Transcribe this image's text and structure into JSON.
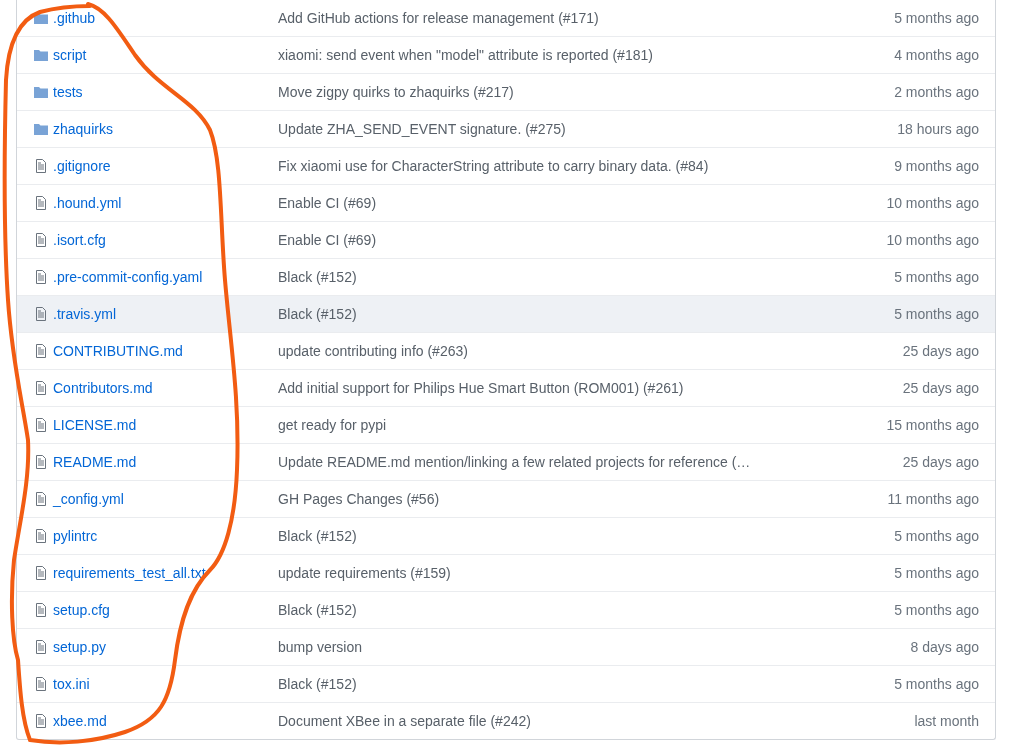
{
  "files": [
    {
      "kind": "dir",
      "name": ".github",
      "message": "Add GitHub actions for release management (#171)",
      "age": "5 months ago",
      "highlighted": false
    },
    {
      "kind": "dir",
      "name": "script",
      "message": "xiaomi: send event when \"model\" attribute is reported (#181)",
      "age": "4 months ago",
      "highlighted": false
    },
    {
      "kind": "dir",
      "name": "tests",
      "message": "Move zigpy quirks to zhaquirks (#217)",
      "age": "2 months ago",
      "highlighted": false
    },
    {
      "kind": "dir",
      "name": "zhaquirks",
      "message": "Update ZHA_SEND_EVENT signature. (#275)",
      "age": "18 hours ago",
      "highlighted": false
    },
    {
      "kind": "file",
      "name": ".gitignore",
      "message": "Fix xiaomi use for CharacterString attribute to carry binary data. (#84)",
      "age": "9 months ago",
      "highlighted": false
    },
    {
      "kind": "file",
      "name": ".hound.yml",
      "message": "Enable CI (#69)",
      "age": "10 months ago",
      "highlighted": false
    },
    {
      "kind": "file",
      "name": ".isort.cfg",
      "message": "Enable CI (#69)",
      "age": "10 months ago",
      "highlighted": false
    },
    {
      "kind": "file",
      "name": ".pre-commit-config.yaml",
      "message": "Black (#152)",
      "age": "5 months ago",
      "highlighted": false
    },
    {
      "kind": "file",
      "name": ".travis.yml",
      "message": "Black (#152)",
      "age": "5 months ago",
      "highlighted": true
    },
    {
      "kind": "file",
      "name": "CONTRIBUTING.md",
      "message": "update contributing info (#263)",
      "age": "25 days ago",
      "highlighted": false
    },
    {
      "kind": "file",
      "name": "Contributors.md",
      "message": "Add initial support for Philips Hue Smart Button (ROM001) (#261)",
      "age": "25 days ago",
      "highlighted": false
    },
    {
      "kind": "file",
      "name": "LICENSE.md",
      "message": "get ready for pypi",
      "age": "15 months ago",
      "highlighted": false
    },
    {
      "kind": "file",
      "name": "README.md",
      "message": "Update README.md mention/linking a few related projects for reference (…",
      "age": "25 days ago",
      "highlighted": false
    },
    {
      "kind": "file",
      "name": "_config.yml",
      "message": "GH Pages Changes (#56)",
      "age": "11 months ago",
      "highlighted": false
    },
    {
      "kind": "file",
      "name": "pylintrc",
      "message": "Black (#152)",
      "age": "5 months ago",
      "highlighted": false
    },
    {
      "kind": "file",
      "name": "requirements_test_all.txt",
      "message": "update requirements (#159)",
      "age": "5 months ago",
      "highlighted": false
    },
    {
      "kind": "file",
      "name": "setup.cfg",
      "message": "Black (#152)",
      "age": "5 months ago",
      "highlighted": false
    },
    {
      "kind": "file",
      "name": "setup.py",
      "message": "bump version",
      "age": "8 days ago",
      "highlighted": false
    },
    {
      "kind": "file",
      "name": "tox.ini",
      "message": "Black (#152)",
      "age": "5 months ago",
      "highlighted": false
    },
    {
      "kind": "file",
      "name": "xbee.md",
      "message": "Document XBee in a separate file (#242)",
      "age": "last month",
      "highlighted": false
    }
  ]
}
